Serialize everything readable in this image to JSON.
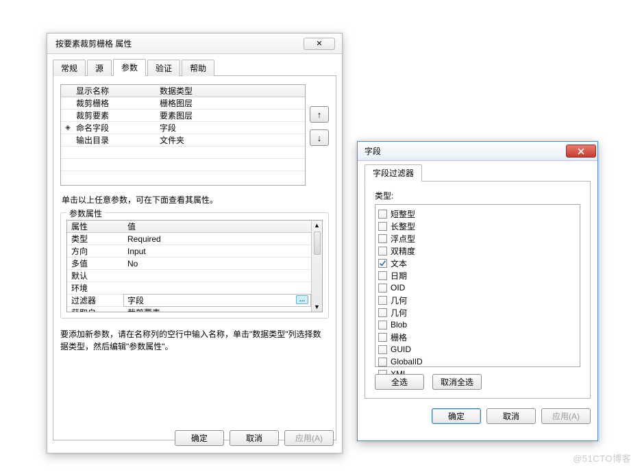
{
  "dlg1": {
    "title": "按要素裁剪栅格 属性",
    "close_label": "✕",
    "tabs": [
      "常规",
      "源",
      "参数",
      "验证",
      "帮助"
    ],
    "active_tab": 2,
    "param_header": {
      "name": "显示名称",
      "type": "数据类型"
    },
    "params": [
      {
        "mark": "",
        "name": "裁剪栅格",
        "type": "栅格图层"
      },
      {
        "mark": "",
        "name": "裁剪要素",
        "type": "要素图层"
      },
      {
        "mark": "◈",
        "name": "命名字段",
        "type": "字段"
      },
      {
        "mark": "",
        "name": "输出目录",
        "type": "文件夹"
      }
    ],
    "move_up_icon": "↑",
    "move_down_icon": "↓",
    "hint1": "单击以上任意参数，可在下面查看其属性。",
    "attr_group_title": "参数属性",
    "attr_header": {
      "prop": "属性",
      "val": "值"
    },
    "attrs": [
      {
        "prop": "类型",
        "val": "Required"
      },
      {
        "prop": "方向",
        "val": "Input"
      },
      {
        "prop": "多值",
        "val": "No"
      },
      {
        "prop": "默认",
        "val": ""
      },
      {
        "prop": "环境",
        "val": ""
      },
      {
        "prop": "过滤器",
        "val": "字段",
        "selected": true
      },
      {
        "prop": "获取自",
        "val": "裁剪要素"
      }
    ],
    "ellipsis_label": "...",
    "help_text": "要添加新参数，请在名称列的空行中输入名称，单击\"数据类型\"列选择数据类型，然后编辑\"参数属性\"。",
    "buttons": {
      "ok": "确定",
      "cancel": "取消",
      "apply": "应用(A)"
    }
  },
  "dlg2": {
    "title": "字段",
    "filter_tab": "字段过滤器",
    "type_label": "类型:",
    "types": [
      {
        "label": "短整型",
        "checked": false
      },
      {
        "label": "长整型",
        "checked": false
      },
      {
        "label": "浮点型",
        "checked": false
      },
      {
        "label": "双精度",
        "checked": false
      },
      {
        "label": "文本",
        "checked": true
      },
      {
        "label": "日期",
        "checked": false
      },
      {
        "label": "OID",
        "checked": false
      },
      {
        "label": "几何",
        "checked": false
      },
      {
        "label": "Blob",
        "checked": false
      },
      {
        "label": "栅格",
        "checked": false
      },
      {
        "label": "GUID",
        "checked": false
      },
      {
        "label": "GlobalID",
        "checked": false
      },
      {
        "label": "XML",
        "checked": false
      }
    ],
    "select_all": "全选",
    "deselect_all": "取消全选",
    "buttons": {
      "ok": "确定",
      "cancel": "取消",
      "apply": "应用(A)"
    }
  },
  "watermark": "@51CTO博客"
}
